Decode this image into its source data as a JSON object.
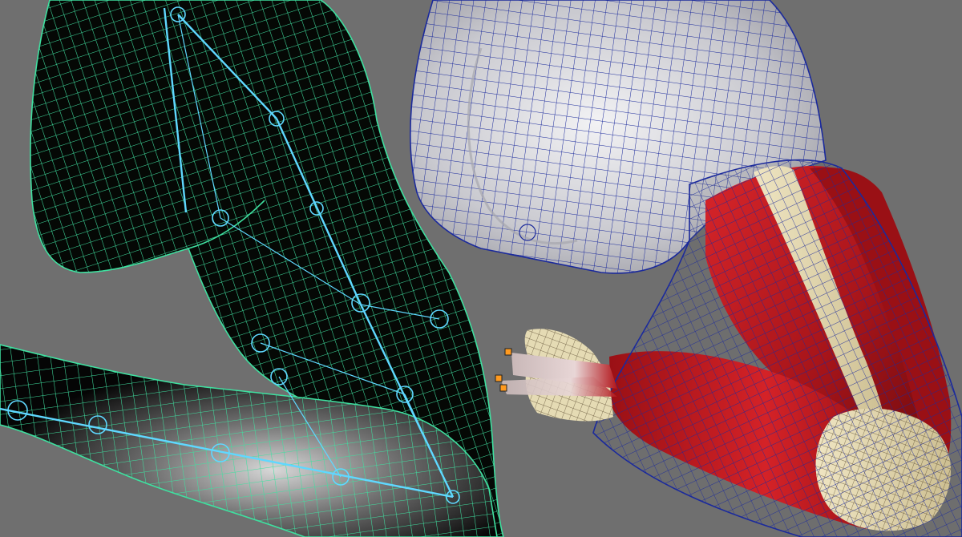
{
  "viewport": {
    "background": "#6f6f6f",
    "panels": [
      {
        "name": "skinned-arm-wireframe",
        "mesh_color": "#3fe0a0",
        "skin_color": "#050805",
        "joint_color": "#5fd8ff"
      },
      {
        "name": "muscle-arm-wireframe",
        "mesh_color": "#1b2a9c",
        "skin_color": "#d9d9dd",
        "muscle_color": "#b8181c",
        "bone_color": "#d8cfa8",
        "locator_color": "#ff9a1f"
      }
    ]
  }
}
